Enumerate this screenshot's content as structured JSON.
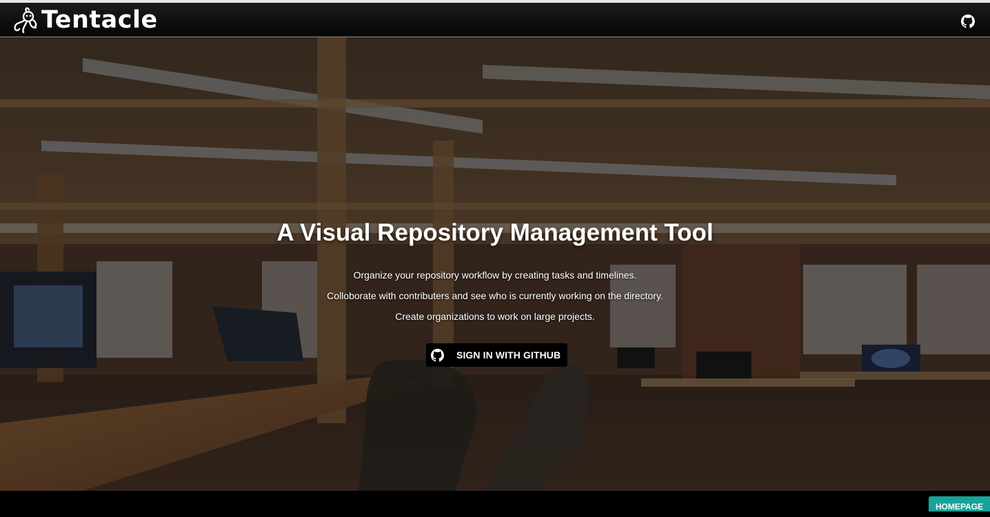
{
  "app": {
    "brand_name": "Tentacle",
    "brand_logo_icon": "octopus-logo-icon",
    "nav_github_icon": "github-icon"
  },
  "hero": {
    "title": "A Visual Repository Management Tool",
    "lines": [
      "Organize your repository workflow by creating tasks and timelines.",
      "Colloborate with contributers and see who is currently working on the directory.",
      "Create organizations to work on large projects."
    ],
    "signin_label": "SIGN IN WITH GITHUB",
    "signin_icon": "github-icon",
    "background": "office-interior-photo"
  },
  "footer": {
    "homepage_label": "HOMEPAGE"
  },
  "colors": {
    "navbar": "#0a0a0a",
    "accent": "#17a398",
    "text": "#ffffff"
  }
}
